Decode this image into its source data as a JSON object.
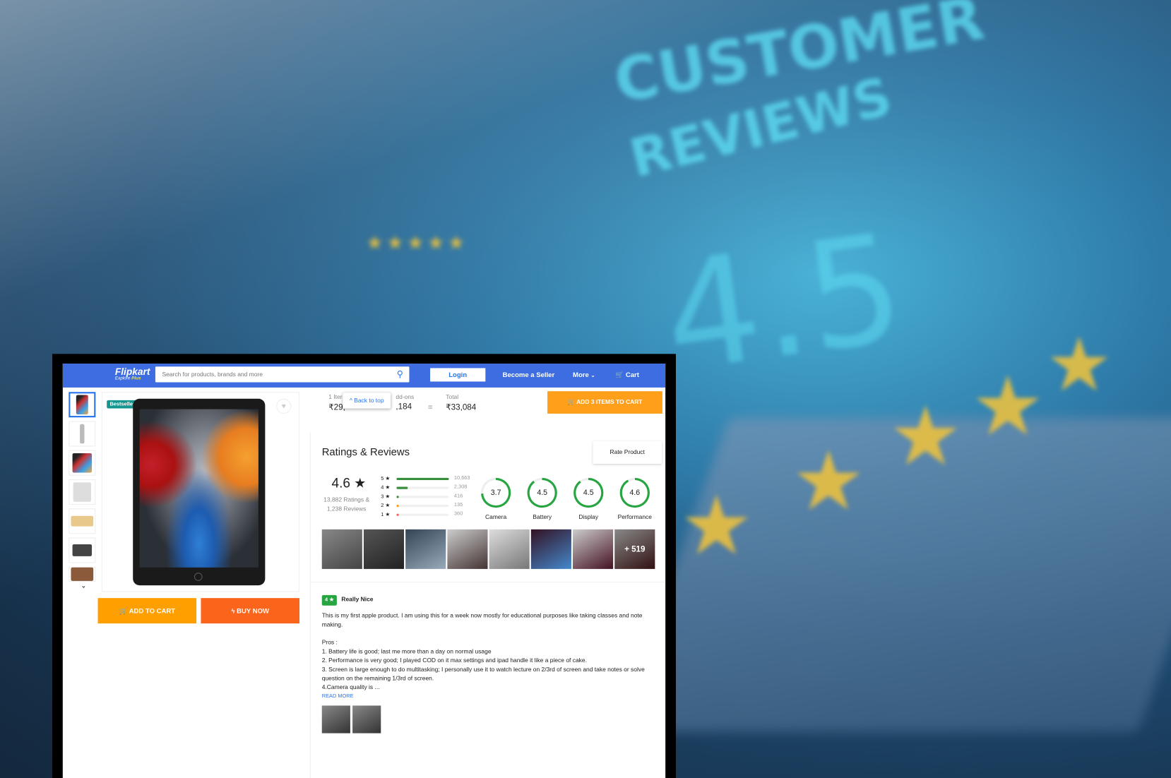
{
  "background": {
    "headline1": "CUSTOMER",
    "headline2": "REVIEWS",
    "score": "4.5"
  },
  "nav": {
    "logo": "Flipkart",
    "logo_sub": "Explore",
    "logo_plus": "Plus",
    "search_placeholder": "Search for products, brands and more",
    "login": "Login",
    "become_seller": "Become a Seller",
    "more": "More",
    "cart": "Cart"
  },
  "product": {
    "badge": "Bestseller",
    "add_to_cart": "ADD TO CART",
    "buy_now": "BUY NOW"
  },
  "cartbar": {
    "items_label": "1 Iter",
    "items_value": "₹29,",
    "addons_label": "dd-ons",
    "addons_value": ",184",
    "equals": "=",
    "total_label": "Total",
    "total_value": "₹33,084",
    "back_to_top": "Back to top",
    "add_all": "ADD 3 ITEMS TO CART"
  },
  "ratings": {
    "title": "Ratings & Reviews",
    "rate_product": "Rate Product",
    "average": "4.6",
    "summary_ratings": "13,882 Ratings &",
    "summary_reviews": "1,238 Reviews",
    "breakdown": [
      {
        "label": "5 ★",
        "count": "10,663",
        "fraction": 1.0,
        "color": "#388e3c"
      },
      {
        "label": "4 ★",
        "count": "2,308",
        "fraction": 0.22,
        "color": "#388e3c"
      },
      {
        "label": "3 ★",
        "count": "416",
        "fraction": 0.04,
        "color": "#388e3c"
      },
      {
        "label": "2 ★",
        "count": "135",
        "fraction": 0.02,
        "color": "#ff9f00"
      },
      {
        "label": "1 ★",
        "count": "360",
        "fraction": 0.03,
        "color": "#ff6161"
      }
    ],
    "features": [
      {
        "name": "Camera",
        "score": "3.7"
      },
      {
        "name": "Battery",
        "score": "4.5"
      },
      {
        "name": "Display",
        "score": "4.5"
      },
      {
        "name": "Performance",
        "score": "4.6"
      }
    ],
    "more_photos": "+ 519"
  },
  "review": {
    "rating": "4 ★",
    "title": "Really Nice",
    "body": "This is my first apple product. I am using this for a week now mostly for educational purposes like taking classes and note making.",
    "pros_label": "Pros :",
    "pros": [
      "1. Battery life is good; last me more than a day on normal usage",
      "2. Performance is very good; I played COD on it max settings and ipad handle it like a piece of cake.",
      "3. Screen is large enough to do multitasking; I personally use it to watch lecture on 2/3rd of screen and take notes or solve question on the remaining 1/3rd of screen.",
      "4.Camera quality is ..."
    ],
    "read_more": "READ MORE"
  }
}
